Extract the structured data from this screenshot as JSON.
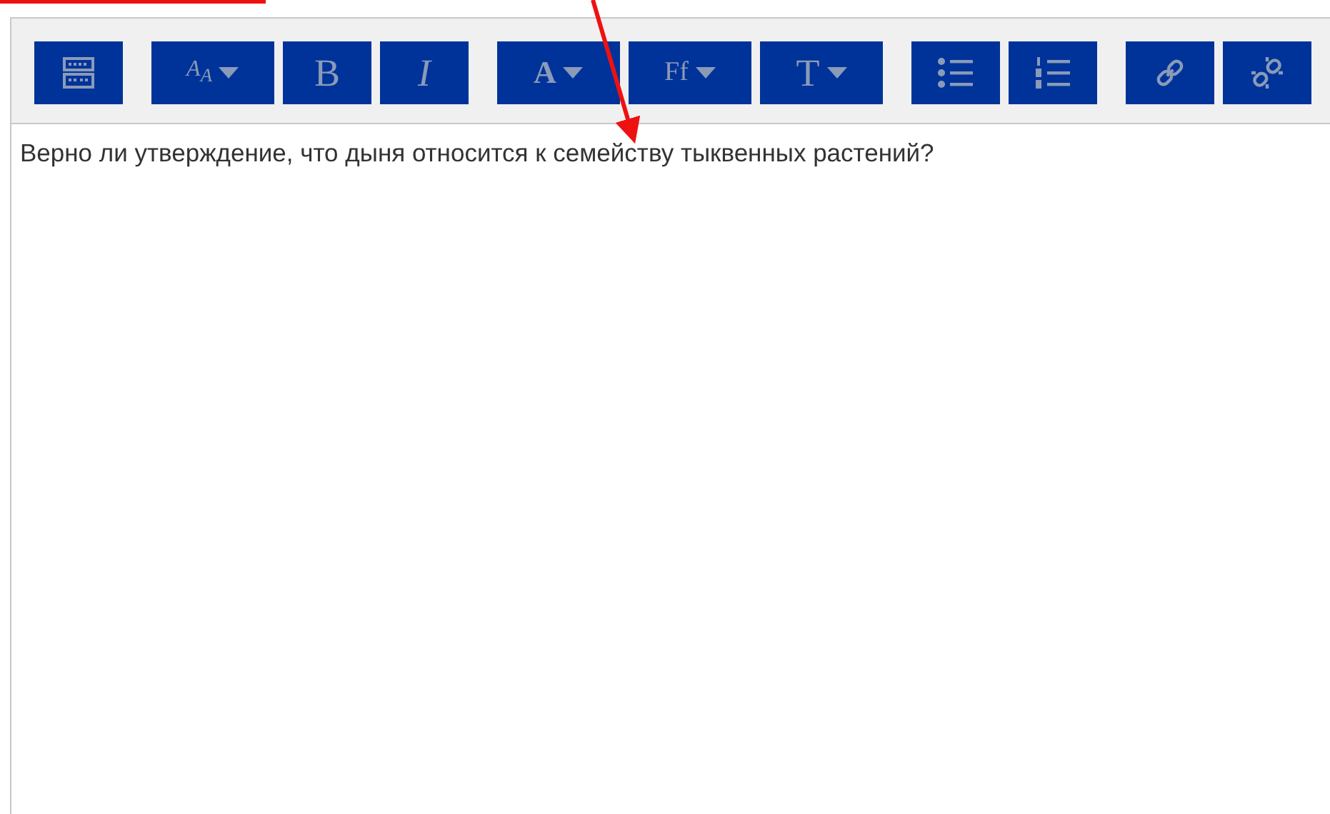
{
  "toolbar": {
    "groups": [
      {
        "buttons": [
          {
            "kind": "toolbar-toggle"
          }
        ]
      },
      {
        "buttons": [
          {
            "kind": "style",
            "glyph": "A$_{A}$"
          },
          {
            "kind": "bold",
            "glyph": "B"
          },
          {
            "kind": "italic",
            "glyph": "I"
          }
        ]
      },
      {
        "buttons": [
          {
            "kind": "font-color",
            "glyph": "A"
          },
          {
            "kind": "font-family",
            "glyph": "Ff"
          },
          {
            "kind": "font-size",
            "glyph": "T"
          }
        ]
      },
      {
        "buttons": [
          {
            "kind": "bullet-list"
          },
          {
            "kind": "numbered-list"
          }
        ]
      },
      {
        "buttons": [
          {
            "kind": "link"
          },
          {
            "kind": "unlink"
          }
        ]
      }
    ]
  },
  "editor": {
    "content": "Верно ли утверждение, что дыня относится к семейству тыквенных растений?"
  }
}
